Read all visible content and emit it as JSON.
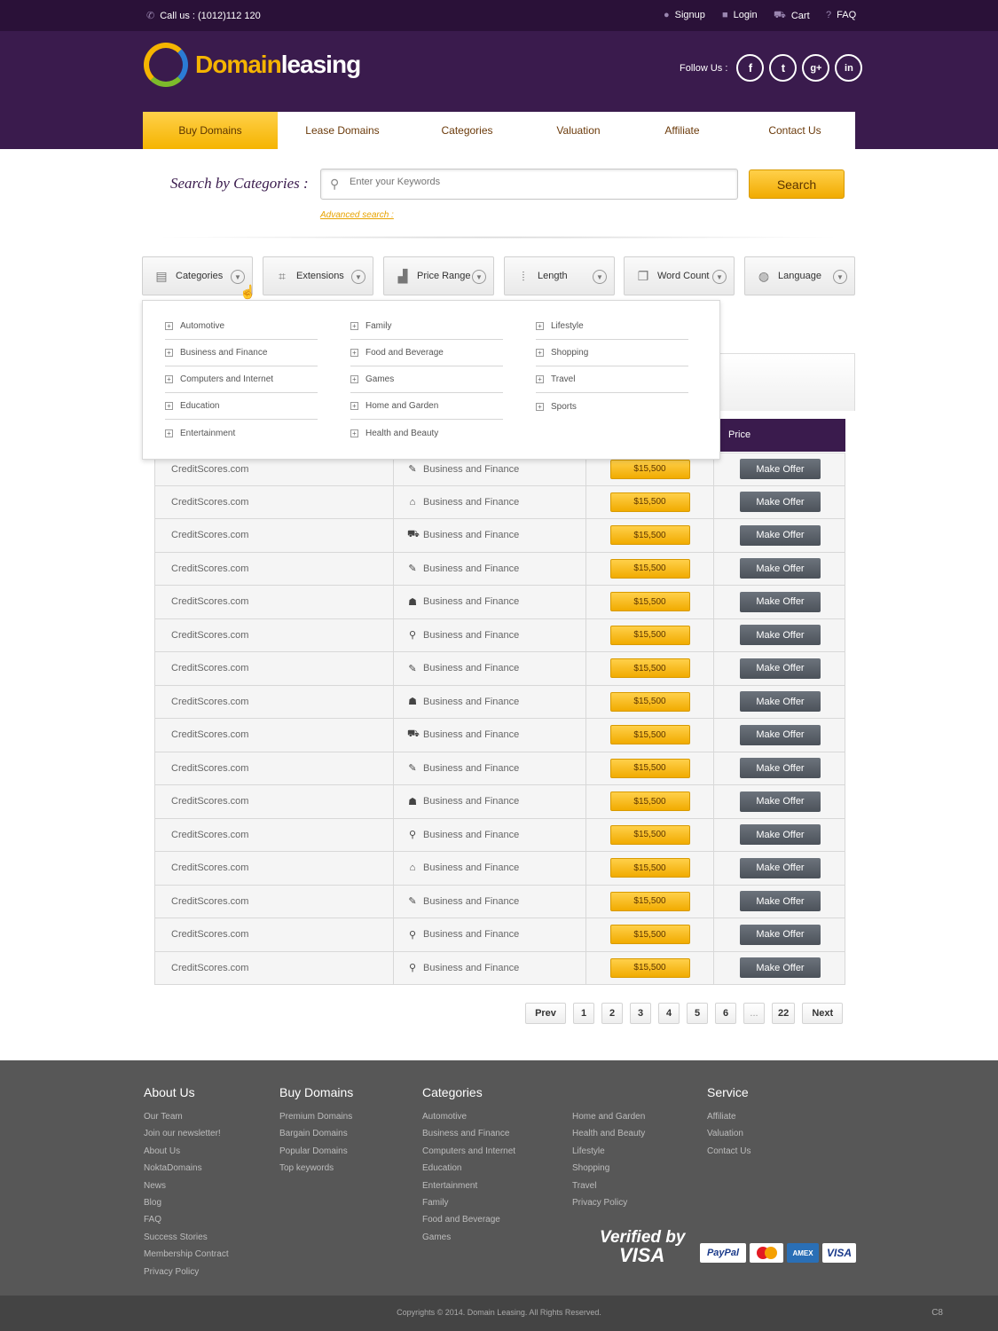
{
  "topbar": {
    "phone": "Call us : (1012)112 120",
    "signup": "Signup",
    "login": "Login",
    "cart": "Cart",
    "faq": "FAQ"
  },
  "brand": {
    "part1": "Domain",
    "part2": "leasing"
  },
  "follow": {
    "label": "Follow Us :",
    "networks": [
      "f",
      "t",
      "g+",
      "in"
    ]
  },
  "nav": [
    "Buy Domains",
    "Lease Domains",
    "Categories",
    "Valuation",
    "Affiliate",
    "Contact Us"
  ],
  "search": {
    "label": "Search by Categories :",
    "placeholder": "Enter your Keywords",
    "button": "Search",
    "advanced": "Advanced search :"
  },
  "filters": [
    {
      "label": "Categories",
      "icon": "clipboard-icon"
    },
    {
      "label": "Extensions",
      "icon": "bracket-icon"
    },
    {
      "label": "Price Range",
      "icon": "bar-chart-icon"
    },
    {
      "label": "Length",
      "icon": "ruler-icon"
    },
    {
      "label": "Word Count",
      "icon": "document-icon"
    },
    {
      "label": "Language",
      "icon": "globe-icon"
    }
  ],
  "dropdown": [
    [
      "Automotive",
      "Business and Finance",
      "Computers and Internet",
      "Education",
      "Entertainment"
    ],
    [
      "Family",
      "Food and Beverage",
      "Games",
      "Home and Garden",
      "Health and Beauty"
    ],
    [
      "Lifestyle",
      "Shopping",
      "Travel",
      "Sports"
    ]
  ],
  "table": {
    "price_header": "Price",
    "rows": [
      {
        "domain": "CreditScores.com",
        "category": "Business and Finance",
        "icon": "rocket-icon",
        "price": "$15,500",
        "action": "Make Offer"
      },
      {
        "domain": "CreditScores.com",
        "category": "Business and Finance",
        "icon": "bank-icon",
        "price": "$15,500",
        "action": "Make Offer"
      },
      {
        "domain": "CreditScores.com",
        "category": "Business and Finance",
        "icon": "cart-icon",
        "price": "$15,500",
        "action": "Make Offer"
      },
      {
        "domain": "CreditScores.com",
        "category": "Business and Finance",
        "icon": "rocket-icon",
        "price": "$15,500",
        "action": "Make Offer"
      },
      {
        "domain": "CreditScores.com",
        "category": "Business and Finance",
        "icon": "graduation-cap-icon",
        "price": "$15,500",
        "action": "Make Offer"
      },
      {
        "domain": "CreditScores.com",
        "category": "Business and Finance",
        "icon": "magnifier-icon",
        "price": "$15,500",
        "action": "Make Offer"
      },
      {
        "domain": "CreditScores.com",
        "category": "Business and Finance",
        "icon": "rocket-icon",
        "price": "$15,500",
        "action": "Make Offer"
      },
      {
        "domain": "CreditScores.com",
        "category": "Business and Finance",
        "icon": "graduation-cap-icon",
        "price": "$15,500",
        "action": "Make Offer"
      },
      {
        "domain": "CreditScores.com",
        "category": "Business and Finance",
        "icon": "cart-icon",
        "price": "$15,500",
        "action": "Make Offer"
      },
      {
        "domain": "CreditScores.com",
        "category": "Business and Finance",
        "icon": "rocket-icon",
        "price": "$15,500",
        "action": "Make Offer"
      },
      {
        "domain": "CreditScores.com",
        "category": "Business and Finance",
        "icon": "graduation-cap-icon",
        "price": "$15,500",
        "action": "Make Offer"
      },
      {
        "domain": "CreditScores.com",
        "category": "Business and Finance",
        "icon": "location-pin-icon",
        "price": "$15,500",
        "action": "Make Offer"
      },
      {
        "domain": "CreditScores.com",
        "category": "Business and Finance",
        "icon": "bank-icon",
        "price": "$15,500",
        "action": "Make Offer"
      },
      {
        "domain": "CreditScores.com",
        "category": "Business and Finance",
        "icon": "rocket-icon",
        "price": "$15,500",
        "action": "Make Offer"
      },
      {
        "domain": "CreditScores.com",
        "category": "Business and Finance",
        "icon": "magnifier-icon",
        "price": "$15,500",
        "action": "Make Offer"
      },
      {
        "domain": "CreditScores.com",
        "category": "Business and Finance",
        "icon": "location-pin-icon",
        "price": "$15,500",
        "action": "Make Offer"
      }
    ]
  },
  "pagination": [
    "Prev",
    "1",
    "2",
    "3",
    "4",
    "5",
    "6",
    "...",
    "22",
    "Next"
  ],
  "footer": {
    "about": {
      "title": "About Us",
      "links": [
        "Our Team",
        "Join our newsletter!",
        "About Us",
        "NoktaDomains",
        "News",
        "Blog",
        "FAQ",
        "Success Stories",
        "Membership Contract",
        "Privacy Policy"
      ]
    },
    "buy": {
      "title": "Buy Domains",
      "links": [
        "Premium Domains",
        "Bargain Domains",
        "Popular Domains",
        "Top keywords"
      ]
    },
    "categories": {
      "title": "Categories",
      "links": [
        "Automotive",
        "Business and Finance",
        "Computers and Internet",
        "Education",
        "Entertainment",
        "Family",
        "Food and Beverage",
        "Games"
      ]
    },
    "categories2": {
      "links": [
        "Home and Garden",
        "Health and Beauty",
        "Lifestyle",
        "Shopping",
        "Travel",
        "Privacy Policy"
      ]
    },
    "service": {
      "title": "Service",
      "links": [
        "Affiliate",
        "Valuation",
        "Contact Us"
      ]
    },
    "verified": {
      "line1": "Verified by",
      "line2": "VISA"
    },
    "cards": {
      "paypal": "PayPal",
      "amex": "AMEX",
      "visa": "VISA"
    },
    "copyright": "Copyrights © 2014. Domain Leasing. All Rights Reserved.",
    "code": "C8"
  },
  "colors": {
    "purple_dark": "#2a1138",
    "purple": "#3a1b4d",
    "gold": "#f5b400",
    "footer": "#575757"
  }
}
